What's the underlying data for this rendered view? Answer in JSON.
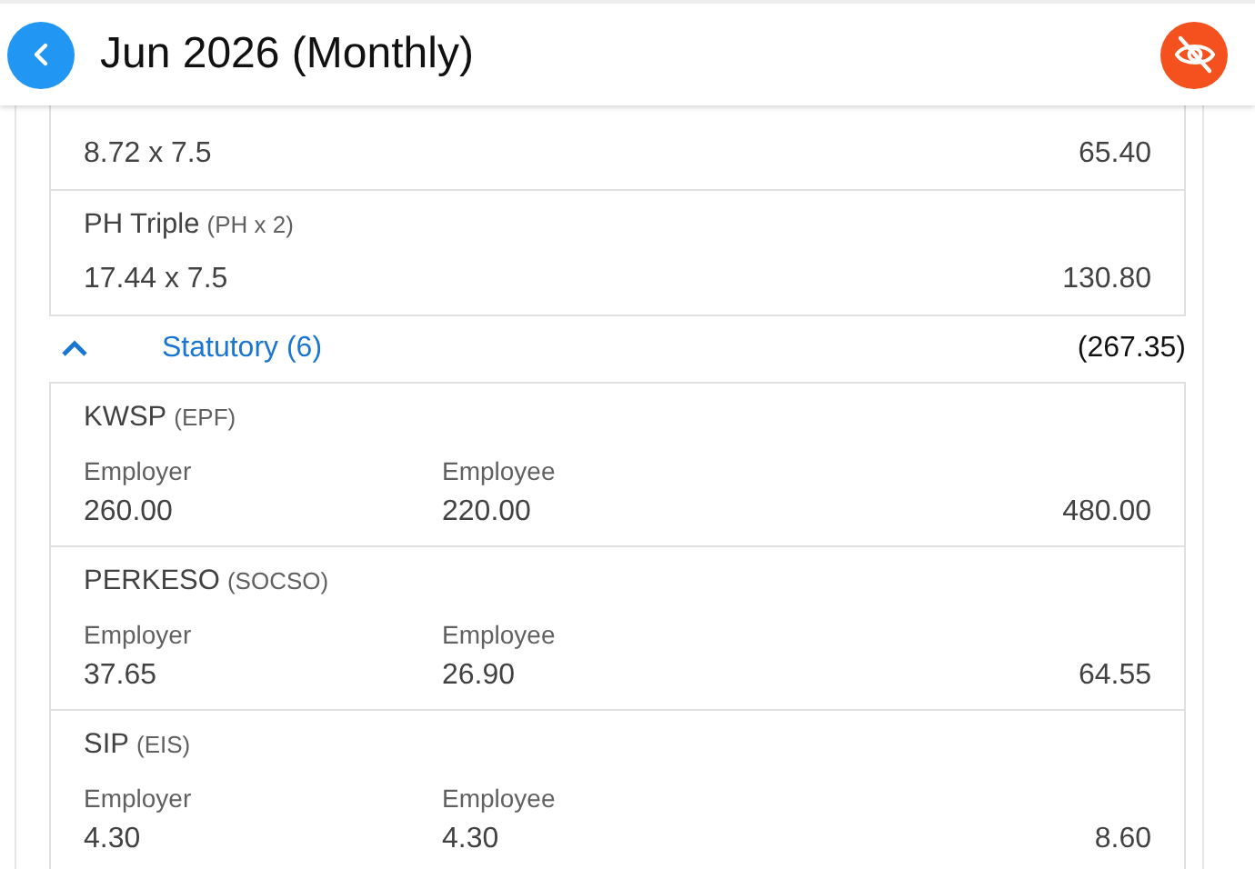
{
  "header": {
    "title": "Jun 2026 (Monthly)"
  },
  "items": [
    {
      "calc": "8.72 x 7.5",
      "amount": "65.40"
    },
    {
      "name": "PH Triple",
      "code": "(PH x 2)",
      "calc": "17.44 x 7.5",
      "amount": "130.80"
    }
  ],
  "section": {
    "label": "Statutory (6)",
    "total": "(267.35)",
    "expanded": true,
    "items": [
      {
        "name": "KWSP",
        "code": "(EPF)",
        "employer_label": "Employer",
        "employer": "260.00",
        "employee_label": "Employee",
        "employee": "220.00",
        "amount": "480.00"
      },
      {
        "name": "PERKESO",
        "code": "(SOCSO)",
        "employer_label": "Employer",
        "employer": "37.65",
        "employee_label": "Employee",
        "employee": "26.90",
        "amount": "64.55"
      },
      {
        "name": "SIP",
        "code": "(EIS)",
        "employer_label": "Employer",
        "employer": "4.30",
        "employee_label": "Employee",
        "employee": "4.30",
        "amount": "8.60"
      }
    ]
  }
}
